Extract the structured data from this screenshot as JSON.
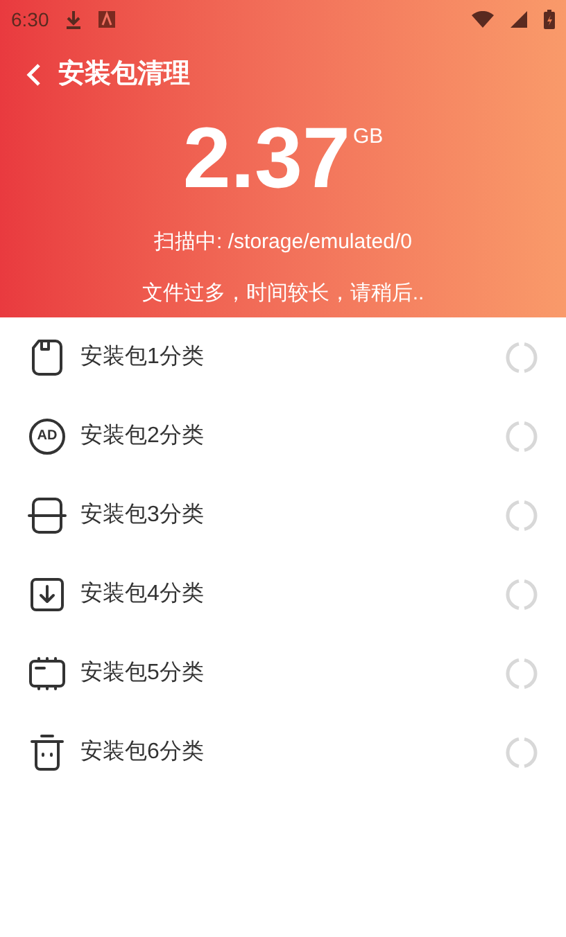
{
  "status_bar": {
    "time": "6:30"
  },
  "header": {
    "title": "安装包清理",
    "size": "2.37",
    "unit": "GB",
    "scanning": "扫描中: /storage/emulated/0",
    "notice": "文件过多，时间较长，请稍后.."
  },
  "categories": [
    {
      "label": "安装包1分类",
      "kind": "sd"
    },
    {
      "label": "安装包2分类",
      "kind": "ad",
      "icon_text": "AD"
    },
    {
      "label": "安装包3分类",
      "kind": "split"
    },
    {
      "label": "安装包4分类",
      "kind": "download"
    },
    {
      "label": "安装包5分类",
      "kind": "chip"
    },
    {
      "label": "安装包6分类",
      "kind": "bin"
    }
  ]
}
